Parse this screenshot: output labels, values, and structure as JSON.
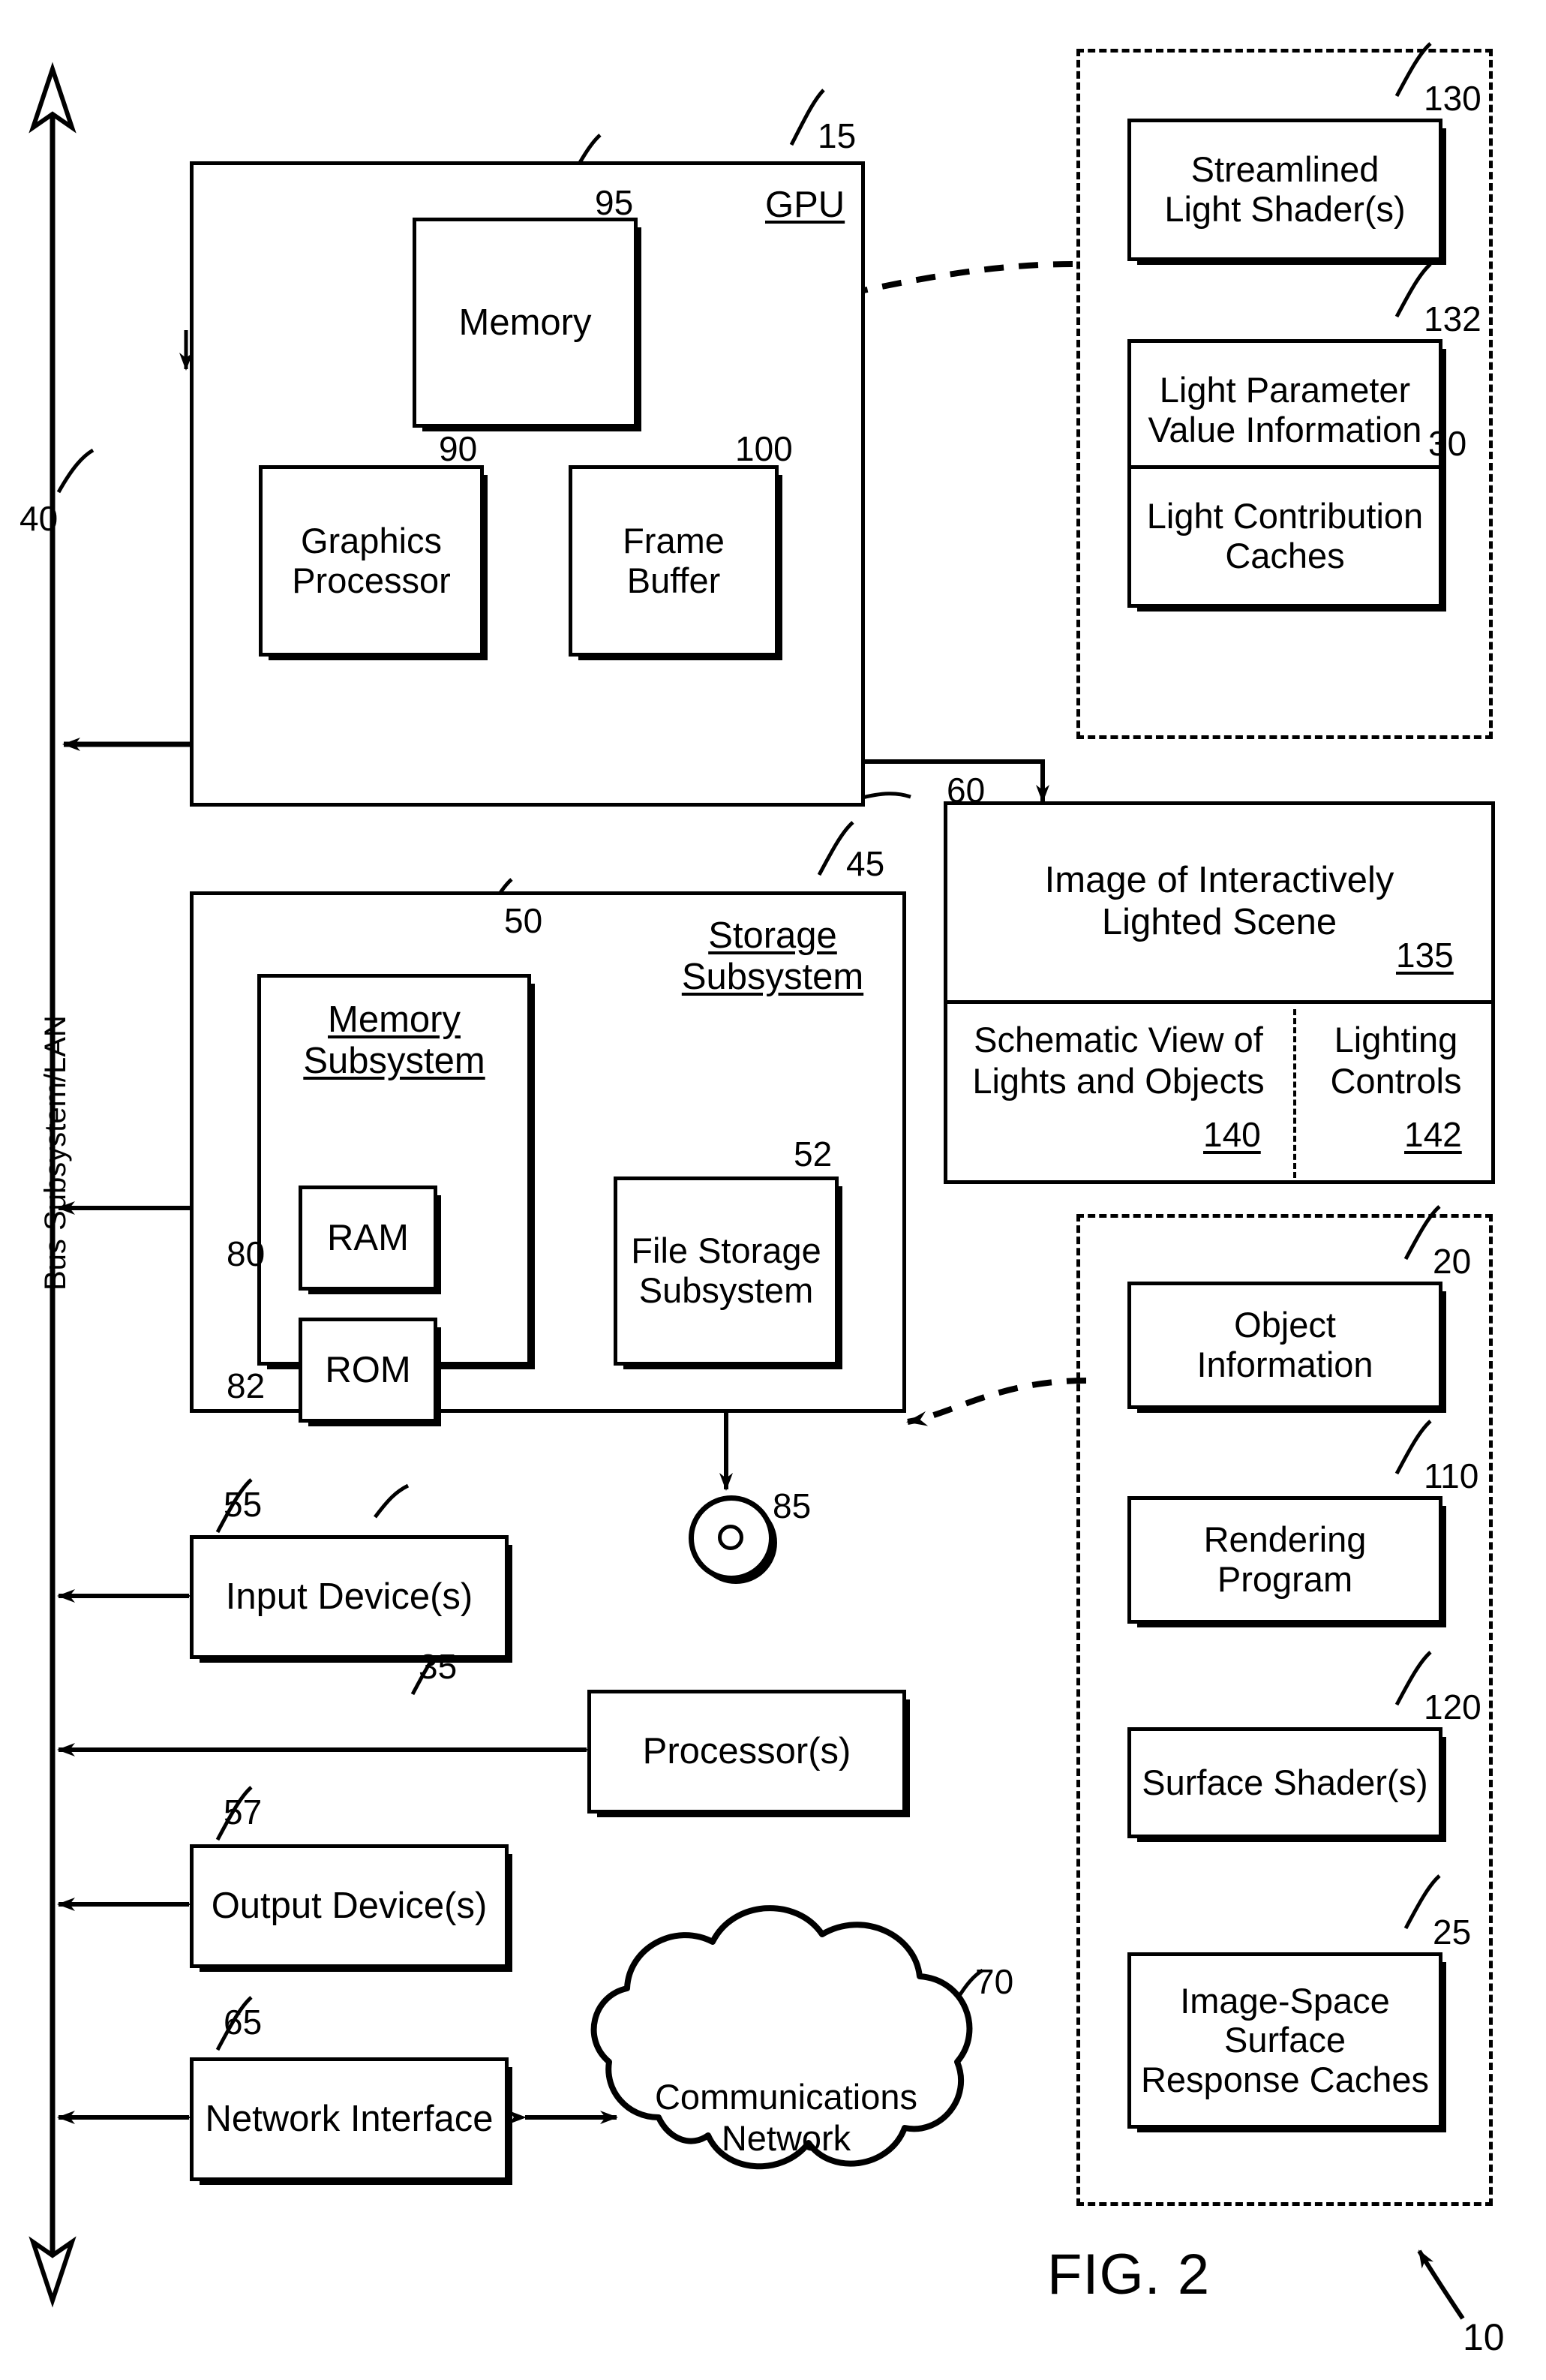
{
  "figure": {
    "caption": "FIG. 2",
    "system_ref": "10"
  },
  "bus": {
    "caption": "Bus Subsystem/LAN",
    "ref": "40"
  },
  "gpu": {
    "ref": "15",
    "title": "GPU",
    "memory": {
      "label": "Memory",
      "ref": "95"
    },
    "graphics_processor": {
      "label": "Graphics\nProcessor",
      "ref": "90"
    },
    "frame_buffer": {
      "label": "Frame\nBuffer",
      "ref": "100"
    }
  },
  "storage_subsystem": {
    "ref": "45",
    "title": "Storage\nSubsystem",
    "memory_subsystem": {
      "ref": "50",
      "title": "Memory\nSubsystem",
      "ram": {
        "label": "RAM",
        "ref": "80"
      },
      "rom": {
        "label": "ROM",
        "ref": "82"
      }
    },
    "file_storage_subsystem": {
      "label": "File Storage\nSubsystem",
      "ref": "52"
    },
    "removable_media": {
      "ref": "85"
    }
  },
  "devices": {
    "input": {
      "label": "Input Device(s)",
      "ref": "55"
    },
    "processors": {
      "label": "Processor(s)",
      "ref": "35"
    },
    "output": {
      "label": "Output Device(s)",
      "ref": "57"
    },
    "network_interface": {
      "label": "Network Interface",
      "ref": "65"
    },
    "communications_network": {
      "label": "Communications\nNetwork",
      "ref": "70"
    }
  },
  "gpu_resident_group": {
    "items": [
      {
        "label": "Streamlined\nLight Shader(s)",
        "ref": "130"
      },
      {
        "label": "Light Parameter\nValue Information",
        "ref": "132"
      },
      {
        "label": "Light Contribution\nCaches",
        "ref": "30"
      }
    ]
  },
  "display_panel": {
    "ref": "60",
    "scene": {
      "label": "Image of Interactively\nLighted Scene",
      "ref": "135"
    },
    "schematic": {
      "label": "Schematic View of\nLights and Objects",
      "ref": "140"
    },
    "controls": {
      "label": "Lighting\nControls",
      "ref": "142"
    }
  },
  "storage_resident_group": {
    "items": [
      {
        "label": "Object\nInformation",
        "ref": "20"
      },
      {
        "label": "Rendering\nProgram",
        "ref": "110"
      },
      {
        "label": "Surface Shader(s)",
        "ref": "120"
      },
      {
        "label": "Image-Space\nSurface\nResponse Caches",
        "ref": "25"
      }
    ]
  }
}
